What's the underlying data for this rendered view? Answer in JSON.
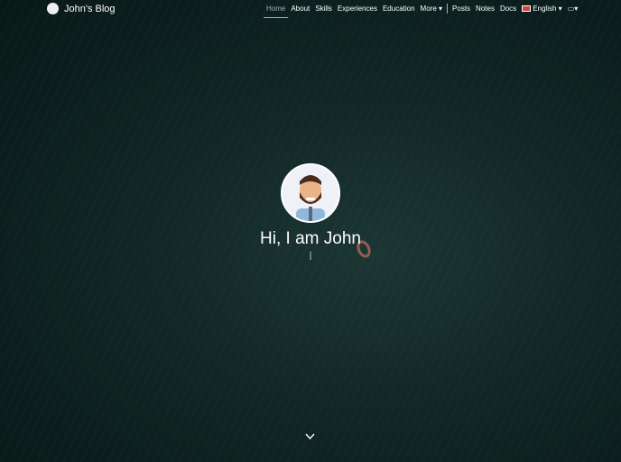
{
  "brand": {
    "title": "John's Blog"
  },
  "nav": {
    "items": [
      "Home",
      "About",
      "Skills",
      "Experiences",
      "Education",
      "More"
    ],
    "items2": [
      "Posts",
      "Notes",
      "Docs"
    ],
    "language": "English"
  },
  "hero": {
    "greeting": "Hi, I am John",
    "typed": "|"
  }
}
